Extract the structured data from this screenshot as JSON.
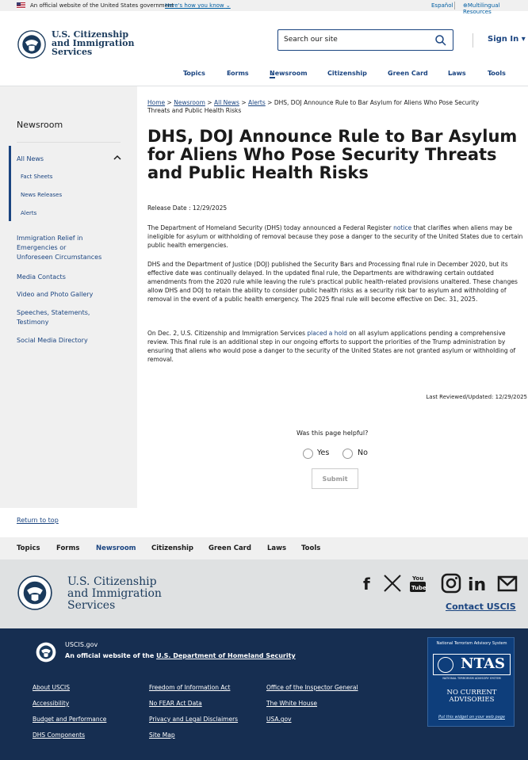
{
  "banner": {
    "official": "An official website of the United States government",
    "know": "Here's how you know",
    "espanol": "Español",
    "multilingual": "Multilingual Resources"
  },
  "header": {
    "logo": [
      "U.S. Citizenship",
      "and Immigration",
      "Services"
    ],
    "search_placeholder": "Search our site",
    "sign_in": "Sign In"
  },
  "topnav": [
    "Topics",
    "Forms",
    "Newsroom",
    "Citizenship",
    "Green Card",
    "Laws",
    "Tools"
  ],
  "sidebar": {
    "title": "Newsroom",
    "all_news": "All News",
    "sub": [
      "Fact Sheets",
      "News Releases",
      "Alerts"
    ],
    "items": [
      "Immigration Relief in",
      "Emergencies or",
      "Unforeseen Circumstances",
      "Media Contacts",
      "Video and Photo Gallery",
      "Speeches, Statements,",
      "Testimony",
      "Social Media Directory"
    ]
  },
  "breadcrumb": {
    "home": "Home",
    "newsroom": "Newsroom",
    "all_news": "All News",
    "alerts": "Alerts",
    "sep": ">",
    "current_1": "DHS, DOJ Announce Rule to Bar Asylum for Aliens Who Pose Security",
    "current_2": "Threats and Public Health Risks"
  },
  "article": {
    "title": "DHS, DOJ Announce Rule to Bar Asylum for Aliens Who Pose Security Threats and Public Health Risks",
    "release": "Release Date : 12/29/2025",
    "p1_a": "The Department of Homeland Security (DHS) today announced a Federal Register",
    "p1_link": "notice",
    "p1_b": "that clarifies when aliens may be ineligible for asylum or withholding of removal because they pose a danger to the security of the United States due to certain public health emergencies.",
    "p2": "DHS and the Department of Justice (DOJ) published the Security Bars and Processing final rule in December 2020, but its effective date was continually delayed. In the updated final rule, the Departments are withdrawing certain outdated amendments from the 2020 rule while leaving the rule's practical public health-related provisions unaltered. These changes allow DHS and DOJ to retain the ability to consider public health risks as a security risk bar to asylum and withholding of removal in the event of a public health emergency. The 2025 final rule will become effective on Dec. 31, 2025.",
    "p3_a": "On Dec. 2, U.S. Citizenship and Immigration Services",
    "p3_link": "placed a hold",
    "p3_b": "on all asylum applications pending a comprehensive review. This final rule is an additional step in our ongoing efforts to support the priorities of the Trump administration by ensuring that aliens who would pose a danger to the security of the United States are not granted asylum or withholding of removal.",
    "last_reviewed": "Last Reviewed/Updated:  12/29/2025"
  },
  "feedback": {
    "question": "Was this page helpful?",
    "yes": "Yes",
    "no": "No",
    "submit": "Submit"
  },
  "footer": {
    "return_top": "Return to top",
    "nav": [
      "Topics",
      "Forms",
      "Newsroom",
      "Citizenship",
      "Green Card",
      "Laws",
      "Tools"
    ],
    "logo": [
      "U.S. Citizenship",
      "and Immigration",
      "Services"
    ],
    "contact": "Contact USCIS",
    "social": [
      "f",
      "X",
      "You Tube",
      "Instagram",
      "in",
      "Email"
    ],
    "uscis_gov": "USCIS.gov",
    "official_a": "An official website of the",
    "official_link": "U.S. Department of Homeland Security",
    "links_col1": [
      "About USCIS",
      "Accessibility",
      "Budget and Performance",
      "DHS Components"
    ],
    "links_col2": [
      "Freedom of Information Act",
      "No FEAR Act Data",
      "Privacy and Legal Disclaimers",
      "Site Map"
    ],
    "links_col3": [
      "Office of the Inspector General",
      "The White House",
      "USA.gov"
    ],
    "ntas": {
      "top": "National Terrorism Advisory System",
      "logo": "NTAS",
      "caption": "NATIONAL TERRORISM ADVISORY SYSTEM",
      "status": "NO CURRENT ADVISORIES",
      "put": "Put this widget on your web page"
    }
  }
}
